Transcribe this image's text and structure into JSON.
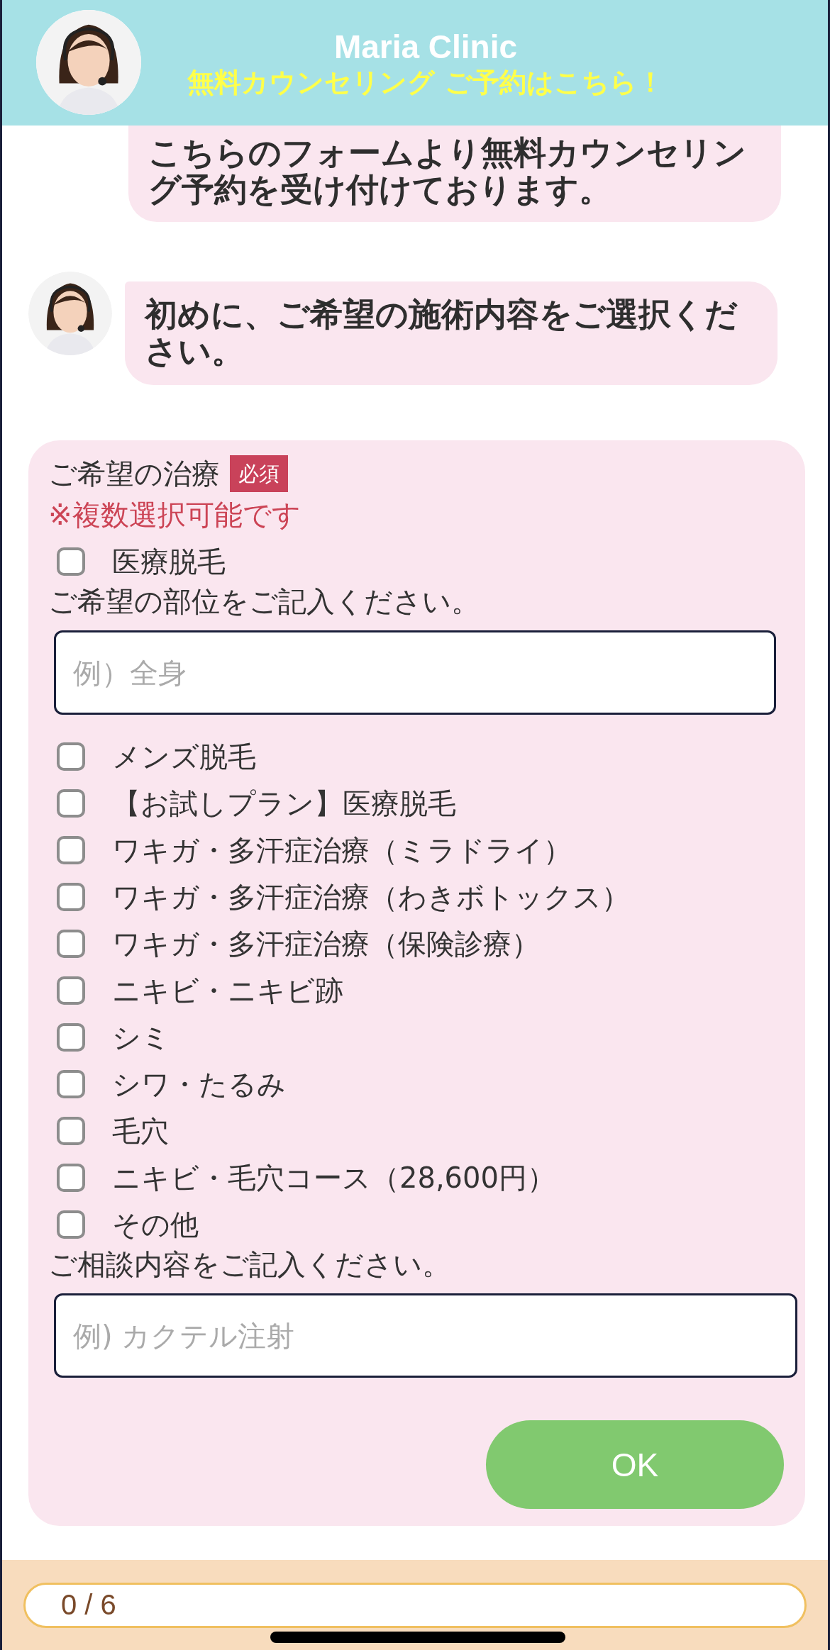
{
  "header": {
    "title": "Maria Clinic",
    "subtitle": "無料カウンセリング ご予約はこちら！"
  },
  "messages": [
    {
      "text": "こちらのフォームより無料カウンセリング予約を受け付けております。",
      "avatar": false,
      "clipped": true
    },
    {
      "text": "初めに、ご希望の施術内容をご選択ください。",
      "avatar": true,
      "clipped": false
    }
  ],
  "form": {
    "label": "ご希望の治療",
    "required_badge": "必須",
    "note": "※複数選択可能です",
    "items": [
      {
        "kind": "checkbox",
        "label": "医療脱毛",
        "checked": false
      },
      {
        "kind": "prompt",
        "text": "ご希望の部位をご記入ください。"
      },
      {
        "kind": "field",
        "placeholder": "例）全身",
        "wide": false
      },
      {
        "kind": "checkbox",
        "label": "メンズ脱毛",
        "checked": false
      },
      {
        "kind": "checkbox",
        "label": "【お試しプラン】医療脱毛",
        "checked": false
      },
      {
        "kind": "checkbox",
        "label": "ワキガ・多汗症治療（ミラドライ）",
        "checked": false
      },
      {
        "kind": "checkbox",
        "label": "ワキガ・多汗症治療（わきボトックス）",
        "checked": false
      },
      {
        "kind": "checkbox",
        "label": "ワキガ・多汗症治療（保険診療）",
        "checked": false
      },
      {
        "kind": "checkbox",
        "label": "ニキビ・ニキビ跡",
        "checked": false
      },
      {
        "kind": "checkbox",
        "label": "シミ",
        "checked": false
      },
      {
        "kind": "checkbox",
        "label": "シワ・たるみ",
        "checked": false
      },
      {
        "kind": "checkbox",
        "label": "毛穴",
        "checked": false
      },
      {
        "kind": "checkbox",
        "label": "ニキビ・毛穴コース（28,600円）",
        "checked": false
      },
      {
        "kind": "checkbox",
        "label": "その他",
        "checked": false
      },
      {
        "kind": "prompt",
        "text": "ご相談内容をご記入ください。"
      },
      {
        "kind": "field",
        "placeholder": "例) カクテル注射",
        "wide": true
      }
    ],
    "button": "OK"
  },
  "progress": {
    "text": "0 / 6"
  }
}
